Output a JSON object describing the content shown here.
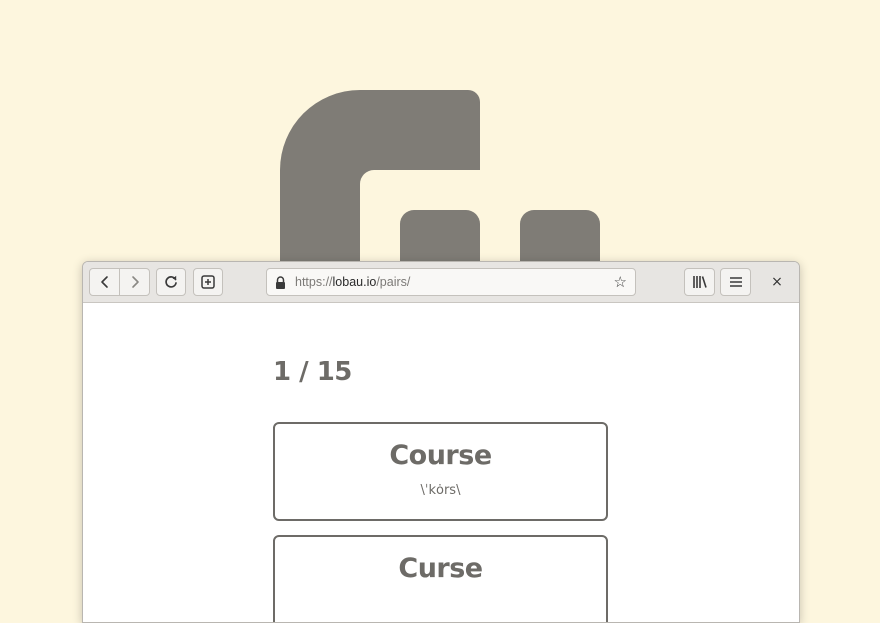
{
  "background": {
    "color": "#fdf6de",
    "logo_color": "#7f7c76"
  },
  "browser": {
    "toolbar": {
      "back_icon": "chevron-left-icon",
      "forward_icon": "chevron-right-icon",
      "reload_icon": "reload-icon",
      "new_tab_icon": "new-tab-icon",
      "library_icon": "library-icon",
      "menu_icon": "hamburger-menu-icon",
      "close_label": "×"
    },
    "address_bar": {
      "protocol": "https://",
      "host": "lobau.io",
      "path": "/pairs/",
      "lock_icon": "lock-icon",
      "bookmark_icon": "star-icon",
      "bookmark_glyph": "☆"
    }
  },
  "quiz": {
    "counter": "1 / 15",
    "cards": [
      {
        "word": "Course",
        "pronunciation": "\\ˈkȯrs\\"
      },
      {
        "word": "Curse",
        "pronunciation": ""
      }
    ]
  }
}
